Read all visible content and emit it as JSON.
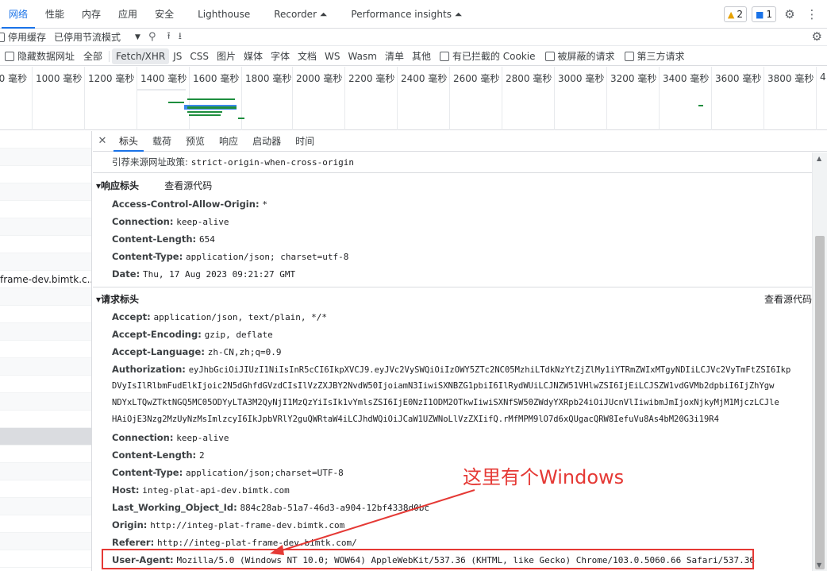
{
  "tabbar": {
    "tabs": [
      "网络",
      "性能",
      "内存",
      "应用",
      "安全",
      "Lighthouse",
      "Recorder ⏶",
      "Performance insights ⏶"
    ],
    "warn_count": "2",
    "msg_count": "1"
  },
  "toolbar2": {
    "disable_cache": "停用缓存",
    "throttle": "已停用节流模式"
  },
  "filters": {
    "hide_data_urls": "隐藏数据网址",
    "types": [
      "全部",
      "Fetch/XHR",
      "JS",
      "CSS",
      "图片",
      "媒体",
      "字体",
      "文档",
      "WS",
      "Wasm",
      "清单",
      "其他"
    ],
    "blocked_cookies": "有已拦截的 Cookie",
    "blocked_requests": "被屏蔽的请求",
    "third_party": "第三方请求"
  },
  "timeline": {
    "ticks": [
      "00 毫秒",
      "1000 毫秒",
      "1200 毫秒",
      "1400 毫秒",
      "1600 毫秒",
      "1800 毫秒",
      "2000 毫秒",
      "2200 毫秒",
      "2400 毫秒",
      "2600 毫秒",
      "2800 毫秒",
      "3000 毫秒",
      "3200 毫秒",
      "3400 毫秒",
      "3600 毫秒",
      "3800 毫秒",
      "4"
    ]
  },
  "leftlist": {
    "visible_text": "frame-dev.bimtk.c..."
  },
  "detail": {
    "tabs": [
      "标头",
      "载荷",
      "预览",
      "响应",
      "启动器",
      "时间"
    ],
    "referrer_policy_key": "引荐来源网址政策:",
    "referrer_policy_val": "strict-origin-when-cross-origin",
    "response_headers_title": "▾响应标头",
    "view_source": "查看源代码",
    "view_source_cut": "查看源代码",
    "response_headers": [
      {
        "k": "Access-Control-Allow-Origin:",
        "v": "*"
      },
      {
        "k": "Connection:",
        "v": "keep-alive"
      },
      {
        "k": "Content-Length:",
        "v": "654"
      },
      {
        "k": "Content-Type:",
        "v": "application/json; charset=utf-8"
      },
      {
        "k": "Date:",
        "v": "Thu, 17 Aug 2023 09:21:27 GMT"
      }
    ],
    "request_headers_title": "▾请求标头",
    "accept_k": "Accept:",
    "accept_v": "application/json, text/plain, */*",
    "accept_enc_k": "Accept-Encoding:",
    "accept_enc_v": "gzip, deflate",
    "accept_lang_k": "Accept-Language:",
    "accept_lang_v": "zh-CN,zh;q=0.9",
    "auth_k": "Authorization:",
    "auth_lines": [
      "eyJhbGciOiJIUzI1NiIsInR5cCI6IkpXVCJ9.eyJVc2VySWQiOiIzOWY5ZTc2NC05MzhiLTdkNzYtZjZlMy1iYTRmZWIxMTgyNDIiLCJVc2VyTmFtZSI6Ikp",
      "DVyIsIlRlbmFudElkIjoic2N5dGhfdGVzdCIsIlVzZXJBY2NvdW50IjoiamN3IiwiSXNBZG1pbiI6IlRydWUiLCJNZW51VHlwZSI6IjEiLCJSZW1vdGVMb2dpbiI6IjZhYgw",
      "NDYxLTQwZTktNGQ5MC05ODYyLTA3M2QyNjI1MzQzYiIsIk1vYmlsZSI6IjE0NzI1ODM2OTkwIiwiSXNfSW50ZWdyYXRpb24iOiJUcnVlIiwibmJmIjoxNjkyMjM1MjczLCJle",
      "HAiOjE3Nzg2MzUyNzMsImlzcyI6IkJpbVRlY2guQWRtaW4iLCJhdWQiOiJCaW1UZWNoLlVzZXIifQ.rMfMPM9lO7d6xQUgacQRW8IefuVu8As4bM20G3i19R4"
    ],
    "conn_k": "Connection:",
    "conn_v": "keep-alive",
    "clen_k": "Content-Length:",
    "clen_v": "2",
    "ctype_k": "Content-Type:",
    "ctype_v": "application/json;charset=UTF-8",
    "host_k": "Host:",
    "host_v": "integ-plat-api-dev.bimtk.com",
    "lwo_k": "Last_Working_Object_Id:",
    "lwo_v": "884c28ab-51a7-46d3-a904-12bf4338d0bc",
    "origin_k": "Origin:",
    "origin_v": "http://integ-plat-frame-dev.bimtk.com",
    "referer_k": "Referer:",
    "referer_v": "http://integ-plat-frame-dev.bimtk.com/",
    "ua_k": "User-Agent:",
    "ua_v": "Mozilla/5.0 (Windows NT 10.0; WOW64) AppleWebKit/537.36 (KHTML, like Gecko) Chrome/103.0.5060.66 Safari/537.36"
  },
  "annotation": {
    "text": "这里有个Windows",
    "color": "#e53935"
  }
}
